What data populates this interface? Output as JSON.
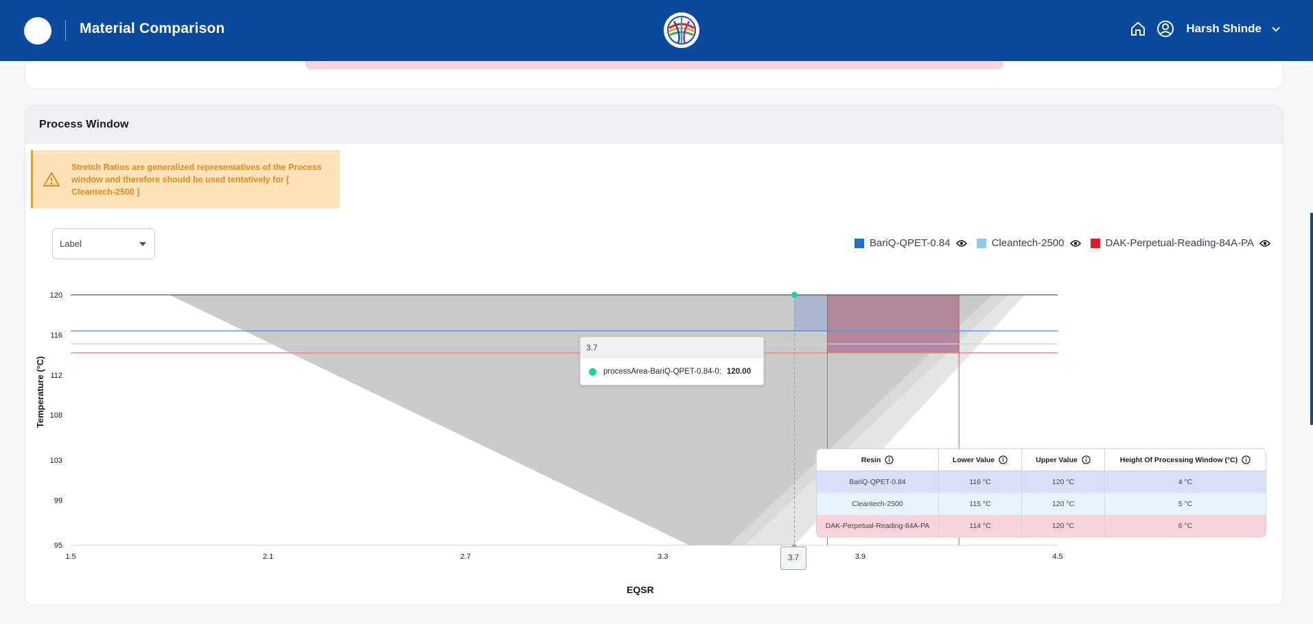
{
  "header": {
    "title": "Material Comparison",
    "user_name": "Harsh Shinde",
    "colors": {
      "bg": "#0a4a9e",
      "text": "#ffffff"
    },
    "icons": [
      "logo-circle",
      "globe-logo-icon",
      "home-icon",
      "user-circle-icon",
      "chevron-down-icon"
    ]
  },
  "process_window": {
    "title": "Process Window",
    "alert": {
      "icon": "warning-triangle-icon",
      "text": "Stretch Ratios are generalized representatives of the Process window and therefore should be used tentatively for [ Cleantech-2500 ]"
    },
    "label_select": {
      "value": "Label"
    },
    "legend": [
      {
        "name": "BariQ-QPET-0.84",
        "color": "#1f6fd1"
      },
      {
        "name": "Cleantech-2500",
        "color": "#8ec9ee"
      },
      {
        "name": "DAK-Perpetual-Reading-84A-PA",
        "color": "#e31b23"
      }
    ],
    "tooltip": {
      "title": "3.7",
      "series": "processArea-BariQ-QPET-0.84-0:",
      "value": "120.00"
    },
    "x_cursor_label": "3.7",
    "table": {
      "headers": [
        "Resin",
        "Lower Value",
        "Upper Value",
        "Height Of Processing Window (°C)"
      ],
      "rows": [
        {
          "resin": "BariQ-QPET-0.84",
          "lower": "116 °C",
          "upper": "120 °C",
          "height": "4 °C",
          "bg": "#d9defa"
        },
        {
          "resin": "Cleantech-2500",
          "lower": "115 °C",
          "upper": "120 °C",
          "height": "5 °C",
          "bg": "#e7f4fb"
        },
        {
          "resin": "DAK-Perpetual-Reading-84A-PA",
          "lower": "114 °C",
          "upper": "120 °C",
          "height": "6 °C",
          "bg": "#f9d3db"
        }
      ]
    }
  },
  "chart_data": {
    "type": "area",
    "xlabel": "EQSR",
    "ylabel": "Temperature (°C)",
    "xlim": [
      1.5,
      4.5
    ],
    "ylim": [
      95,
      120
    ],
    "x_ticks": [
      "1.5",
      "2.1",
      "2.7",
      "3.3",
      "3.9",
      "4.5"
    ],
    "y_ticks": [
      "120",
      "116",
      "112",
      "108",
      "103",
      "99",
      "95"
    ],
    "reference_lines": [
      {
        "series": "BariQ-QPET-0.84",
        "y": 116.4,
        "color": "#5b8fd8"
      },
      {
        "series": "Cleantech-2500",
        "y": 115.1,
        "color": "#b8dcf2"
      },
      {
        "series": "DAK-Perpetual-Reading-84A-PA",
        "y": 114.2,
        "color": "#e8848c"
      }
    ],
    "process_areas": [
      {
        "name": "gray-area-1",
        "points": [
          [
            1.8,
            120
          ],
          [
            4.3,
            120
          ],
          [
            3.5,
            95
          ],
          [
            3.38,
            95
          ]
        ]
      },
      {
        "name": "gray-area-2",
        "points": [
          [
            1.8,
            120
          ],
          [
            4.35,
            120
          ],
          [
            3.55,
            95
          ],
          [
            3.4,
            95
          ]
        ]
      },
      {
        "name": "gray-area-3",
        "points": [
          [
            1.8,
            120
          ],
          [
            4.4,
            120
          ],
          [
            3.7,
            95
          ],
          [
            3.5,
            95
          ]
        ]
      }
    ],
    "bariq_region": {
      "x": [
        3.7,
        3.8
      ],
      "y": [
        116.4,
        120
      ]
    },
    "dak_region": {
      "x": [
        3.8,
        4.2
      ],
      "y": [
        114.2,
        120
      ]
    },
    "dak_verticals": [
      3.8,
      4.2
    ],
    "hover_point": {
      "x": 3.7,
      "y": 120
    }
  }
}
